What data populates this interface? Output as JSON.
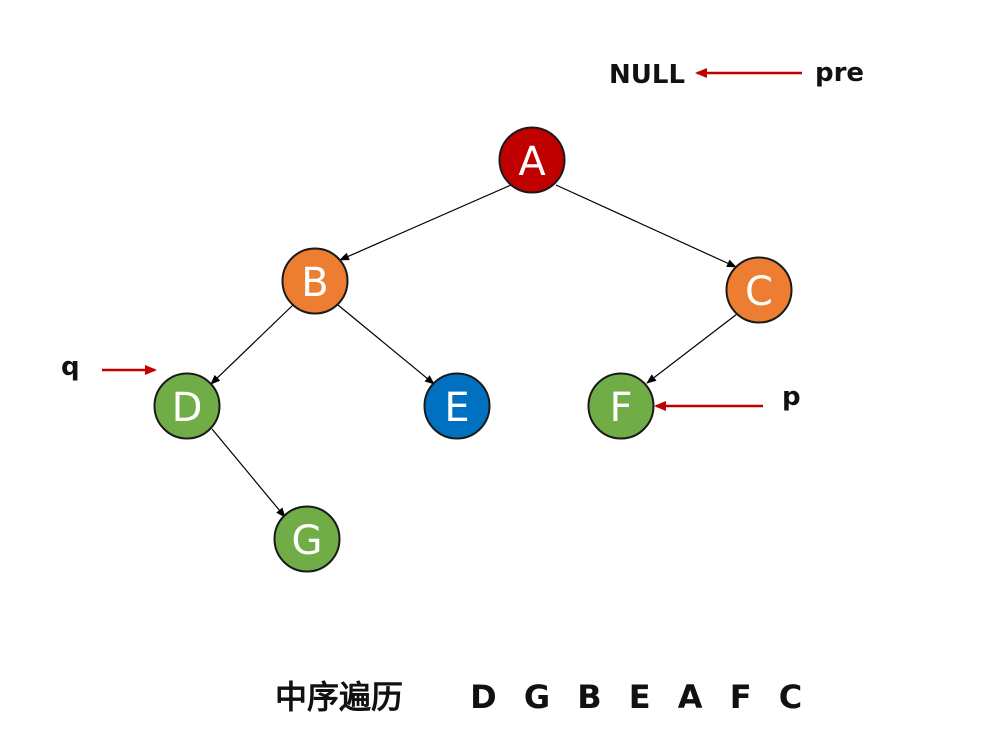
{
  "pointers": {
    "null_label": "NULL",
    "pre_label": "pre",
    "q_label": "q",
    "p_label": "p"
  },
  "nodes": {
    "A": {
      "label": "A",
      "color": "#C00000"
    },
    "B": {
      "label": "B",
      "color": "#ED7D31"
    },
    "C": {
      "label": "C",
      "color": "#ED7D31"
    },
    "D": {
      "label": "D",
      "color": "#70AD47"
    },
    "E": {
      "label": "E",
      "color": "#0070C0"
    },
    "F": {
      "label": "F",
      "color": "#70AD47"
    },
    "G": {
      "label": "G",
      "color": "#70AD47"
    }
  },
  "edges": [
    {
      "from": "A",
      "to": "B"
    },
    {
      "from": "A",
      "to": "C"
    },
    {
      "from": "B",
      "to": "D"
    },
    {
      "from": "B",
      "to": "E"
    },
    {
      "from": "C",
      "to": "F"
    },
    {
      "from": "D",
      "to": "G"
    }
  ],
  "caption": {
    "title": "中序遍历",
    "sequence": "D G B E A F C"
  },
  "colors": {
    "pointer_arrow": "#C00000",
    "edge": "#000000",
    "node_border": "#1a1a1a"
  }
}
